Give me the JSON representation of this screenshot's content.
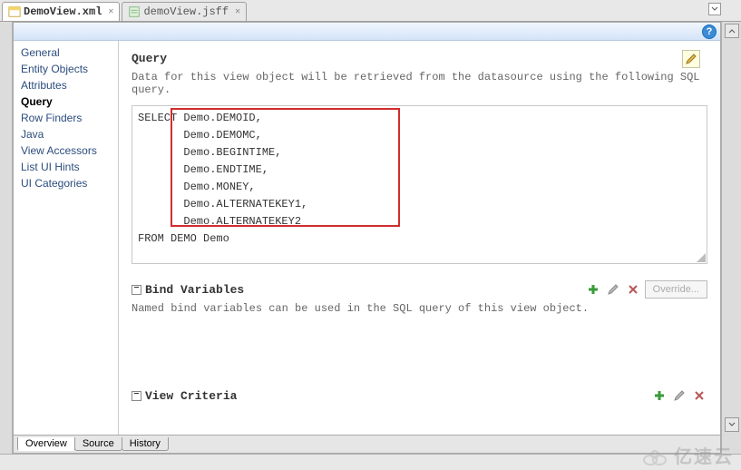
{
  "tabs": {
    "active": {
      "label": "DemoView.xml"
    },
    "inactive": {
      "label": "demoView.jsff"
    }
  },
  "sidebar": {
    "items": [
      "General",
      "Entity Objects",
      "Attributes",
      "Query",
      "Row Finders",
      "Java",
      "View Accessors",
      "List UI Hints",
      "UI Categories"
    ],
    "selected_index": 3
  },
  "query_section": {
    "title": "Query",
    "description": "Data for this view object will be retrieved from the datasource using the following SQL query.",
    "sql": "SELECT Demo.DEMOID,\n       Demo.DEMOMC,\n       Demo.BEGINTIME,\n       Demo.ENDTIME,\n       Demo.MONEY,\n       Demo.ALTERNATEKEY1,\n       Demo.ALTERNATEKEY2\nFROM DEMO Demo"
  },
  "bind_section": {
    "title": "Bind Variables",
    "description": "Named bind variables can be used in the SQL query of this view object.",
    "override_label": "Override..."
  },
  "view_criteria_section": {
    "title": "View Criteria"
  },
  "bottom_tabs": [
    "Overview",
    "Source",
    "History"
  ],
  "watermark": "亿速云"
}
